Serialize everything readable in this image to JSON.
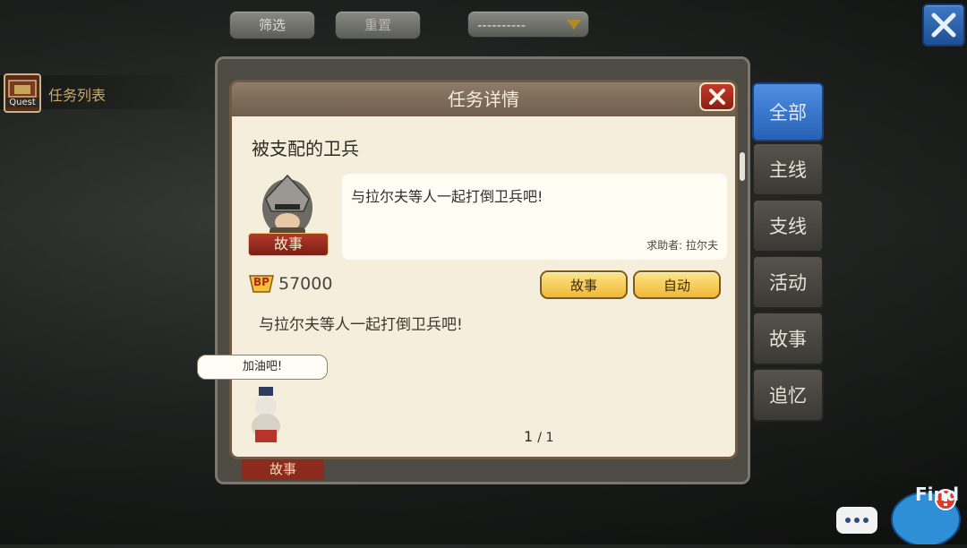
{
  "top_bar": {
    "filter_label": "筛选",
    "reset_label": "重置",
    "dropdown_value": "----------"
  },
  "quest_list": {
    "icon_caption": "Quest",
    "label": "任务列表"
  },
  "side_tabs": [
    {
      "label": "全部",
      "active": true
    },
    {
      "label": "主线",
      "active": false
    },
    {
      "label": "支线",
      "active": false
    },
    {
      "label": "活动",
      "active": false
    },
    {
      "label": "故事",
      "active": false
    },
    {
      "label": "追忆",
      "active": false
    }
  ],
  "dialog": {
    "title": "任务详情",
    "quest_name": "被支配的卫兵",
    "portrait_badge": "故事",
    "description": "与拉尔夫等人一起打倒卫兵吧!",
    "helper": "求助者: 拉尔夫",
    "bp_icon_text": "BP",
    "bp_value": "57000",
    "story_button": "故事",
    "auto_button": "自动",
    "body_text": "与拉尔夫等人一起打倒卫兵吧!",
    "speech": "加油吧!",
    "page": "1",
    "page_total": "/ 1",
    "behind_badge": "故事"
  },
  "find_widget": {
    "label": "Find"
  },
  "colors": {
    "active_tab": "#3a78cc",
    "dialog_bg": "#f6eedc",
    "gold_button": "#f0b835",
    "close_red": "#b22e20"
  }
}
